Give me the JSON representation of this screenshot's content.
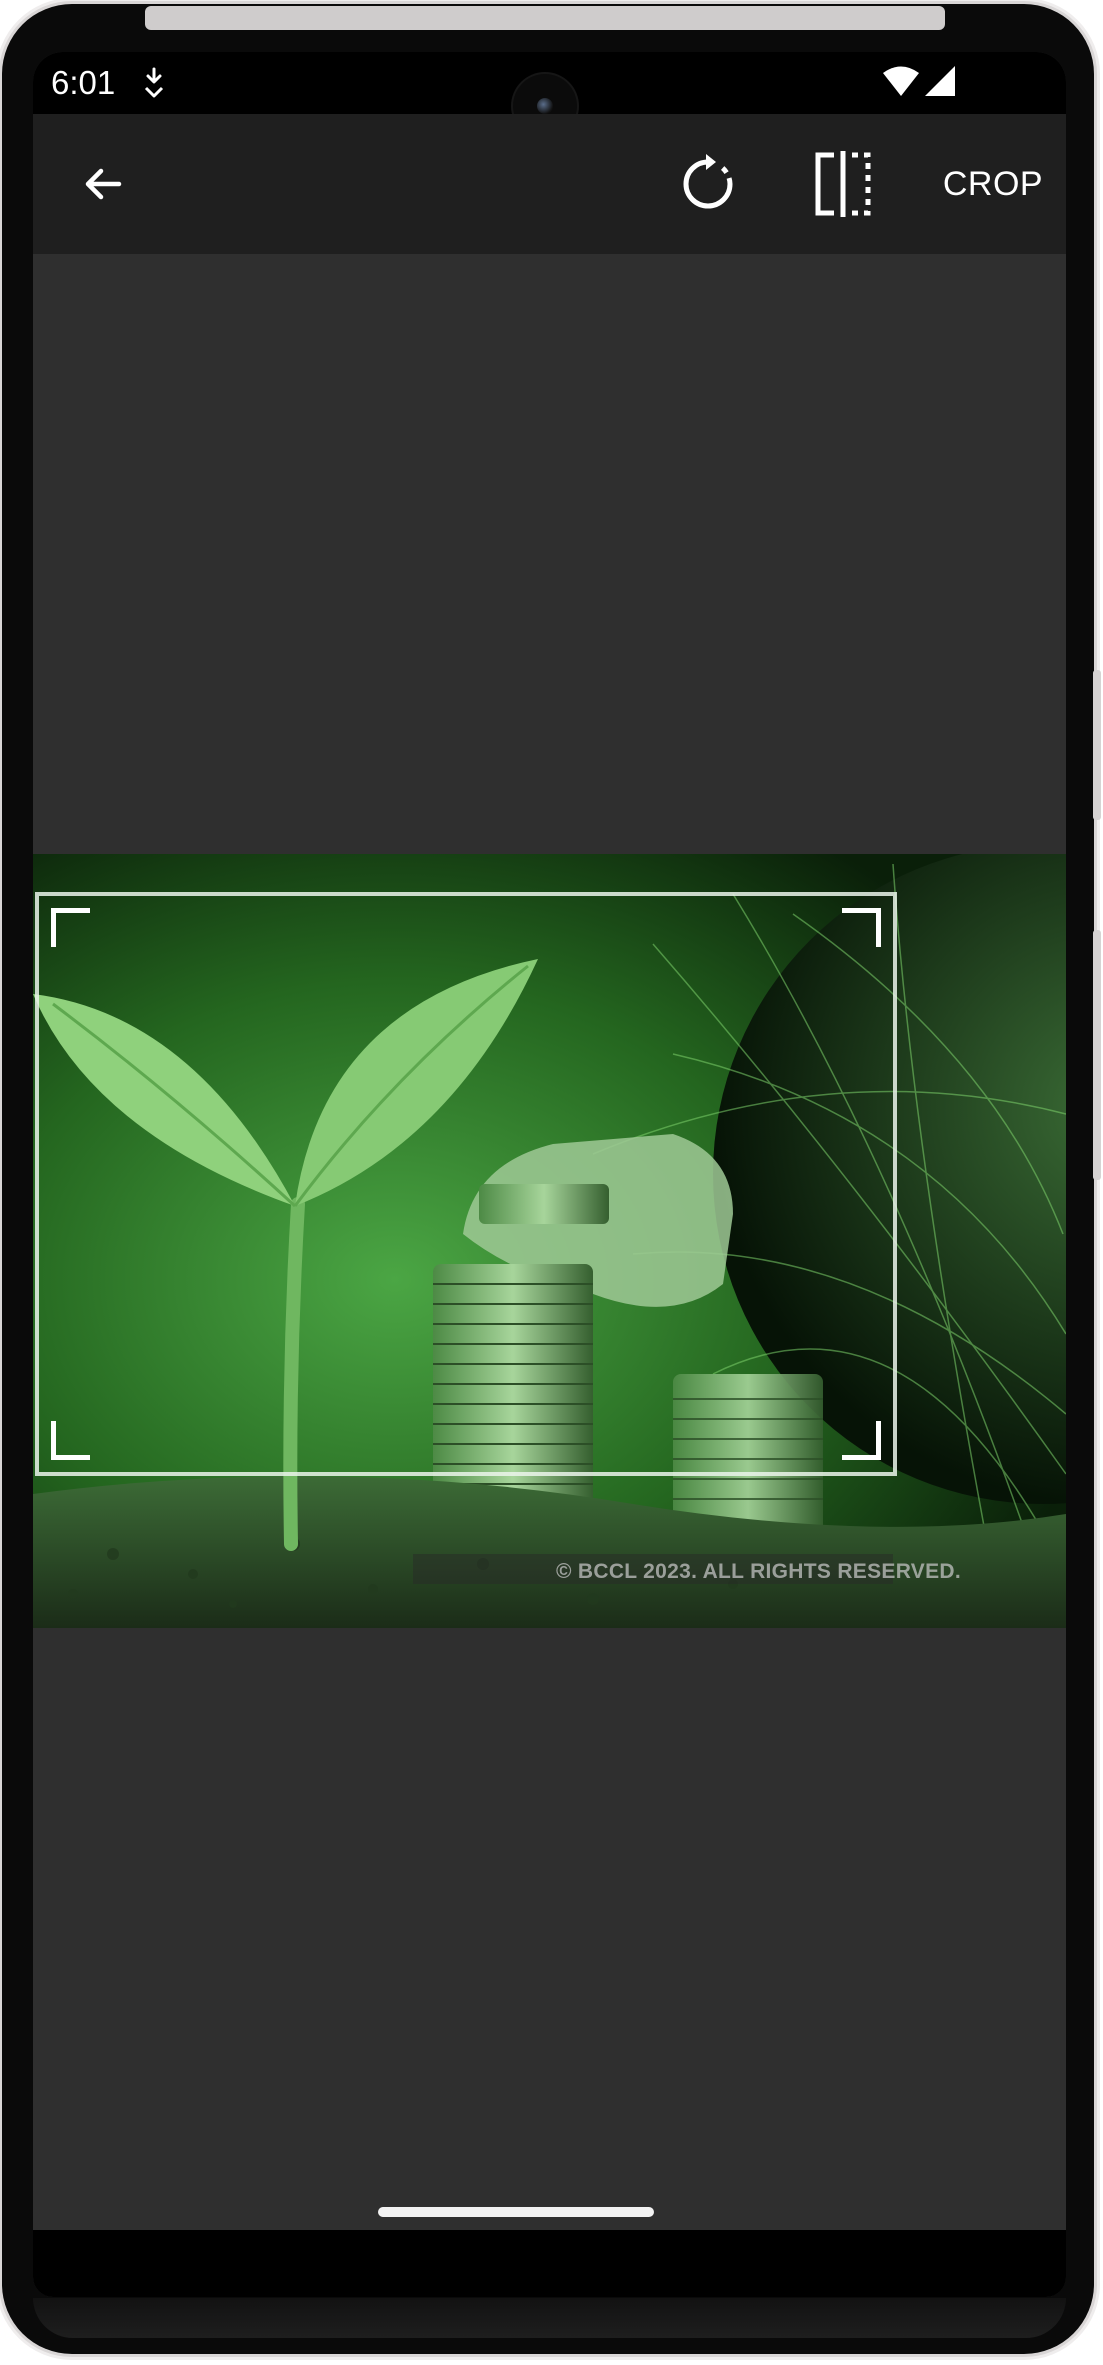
{
  "status_bar": {
    "time": "6:01",
    "notification_icon": "download-notification-icon",
    "wifi_icon": "wifi-icon",
    "signal_icon": "cell-signal-icon"
  },
  "toolbar": {
    "back_icon": "arrow-back-icon",
    "rotate_icon": "rotate-icon",
    "flip_icon": "flip-horizontal-icon",
    "crop_label": "CROP"
  },
  "image": {
    "watermark": "© BCCL 2023. ALL RIGHTS RESERVED."
  },
  "colors": {
    "toolbar_bg": "#1f1f1f",
    "canvas_bg": "#2f2f2f",
    "photo_tint": "#3fa03a",
    "crop_frame": "#ebf5eb"
  }
}
